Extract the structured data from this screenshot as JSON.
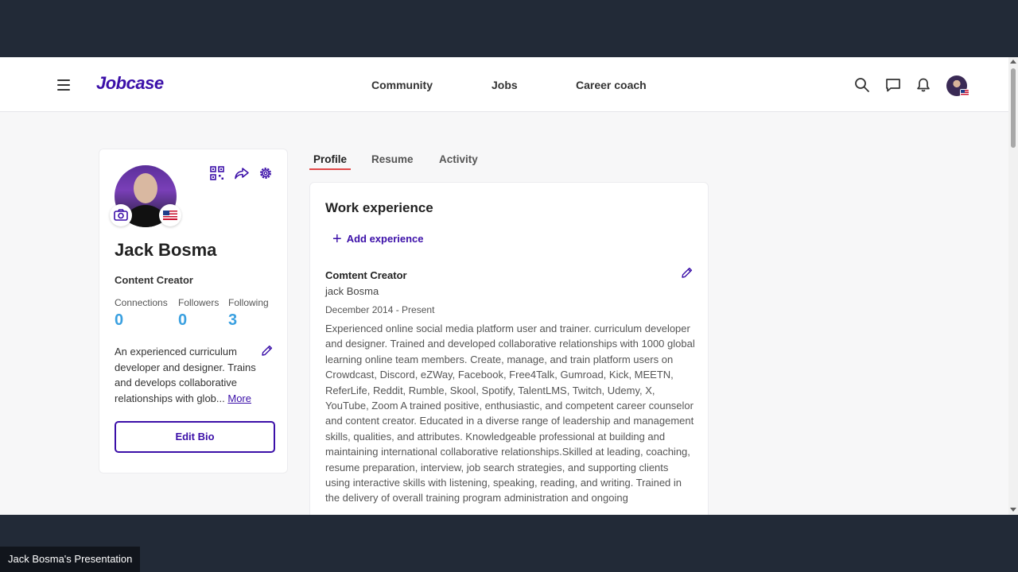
{
  "header": {
    "logo": "Jobcase",
    "nav": [
      "Community",
      "Jobs",
      "Career coach"
    ]
  },
  "icons": {
    "menu": "hamburger-icon",
    "search": "search-icon",
    "messages": "chat-icon",
    "notifications": "bell-icon",
    "qr": "qr-code-icon",
    "share": "share-icon",
    "settings": "gear-icon",
    "camera": "camera-icon",
    "edit": "pencil-icon",
    "add": "plus-icon"
  },
  "profile": {
    "name": "Jack Bosma",
    "headline": "Content Creator",
    "stats": [
      {
        "label": "Connections",
        "value": "0"
      },
      {
        "label": "Followers",
        "value": "0"
      },
      {
        "label": "Following",
        "value": "3"
      }
    ],
    "bio": "An experienced curriculum developer and designer. Trains and develops collaborative relationships with glob...",
    "more_label": "More",
    "edit_bio_label": "Edit Bio"
  },
  "tabs": [
    {
      "label": "Profile",
      "active": true
    },
    {
      "label": "Resume",
      "active": false
    },
    {
      "label": "Activity",
      "active": false
    }
  ],
  "work": {
    "title": "Work experience",
    "add_label": "Add experience",
    "job": {
      "title": "Comtent Creator",
      "company": "jack Bosma",
      "dates": "December 2014 - Present",
      "description": "Experienced online social media platform user and trainer. curriculum developer and designer. Trained and developed collaborative relationships with 1000 global learning online team members. Create, manage, and train platform users on Crowdcast, Discord, eZWay, Facebook, Free4Talk, Gumroad, Kick, MEETN, ReferLife, Reddit, Rumble, Skool, Spotify, TalentLMS, Twitch, Udemy, X, YouTube, Zoom A trained positive, enthusiastic, and competent career counselor and content creator. Educated in a diverse range of leadership and management skills, qualities, and attributes. Knowledgeable professional at building and maintaining international collaborative relationships.Skilled at leading, coaching, resume preparation, interview, job search strategies, and supporting clients using interactive skills with listening, speaking, reading, and writing. Trained in the delivery of overall training program administration and ongoing"
    }
  },
  "presenter_label": "Jack Bosma's Presentation",
  "colors": {
    "brand": "#3b0fa8",
    "stat": "#3aa0e0",
    "tab_underline": "#e04848",
    "backdrop": "#222a37"
  }
}
